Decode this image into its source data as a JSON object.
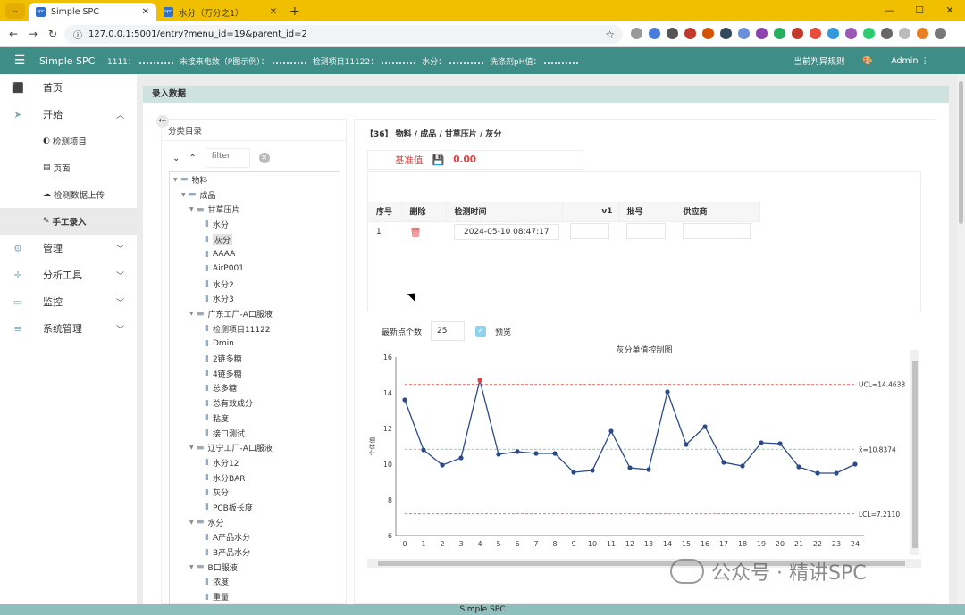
{
  "browser": {
    "tabs": [
      {
        "title": "Simple SPC",
        "active": true
      },
      {
        "title": "水分（万分之1）",
        "active": false
      }
    ],
    "url": "127.0.0.1:5001/entry?menu_id=19&parent_id=2",
    "window_controls": [
      "—",
      "☐",
      "✕"
    ]
  },
  "appbar": {
    "app_name": "Simple SPC",
    "ticker": [
      "1111：",
      "未接来电数（P图示例）：",
      "检测项目11122：",
      "水分：",
      "洗涤剂pH值："
    ],
    "rule_label": "当前判异规则",
    "user": "Admin"
  },
  "sidebar": {
    "items": [
      {
        "label": "首页",
        "icon": "home-icon"
      },
      {
        "label": "开始",
        "icon": "send-icon",
        "expanded": true
      },
      {
        "label": "管理",
        "icon": "gear-icon"
      },
      {
        "label": "分析工具",
        "icon": "crosshair-icon"
      },
      {
        "label": "监控",
        "icon": "monitor-icon"
      },
      {
        "label": "系统管理",
        "icon": "list-icon"
      }
    ],
    "sub_items": [
      {
        "label": "检测项目",
        "icon": "contrast-icon"
      },
      {
        "label": "页面",
        "icon": "book-icon"
      },
      {
        "label": "检测数据上传",
        "icon": "cloud-upload-icon"
      },
      {
        "label": "手工录入",
        "icon": "pen-icon",
        "active": true
      }
    ]
  },
  "page": {
    "title": "录入数据",
    "tree_title": "分类目录",
    "filter_placeholder": "filter",
    "breadcrumb": "【36】 物料 / 成品 / 甘草压片 / 灰分",
    "base_label": "基准值",
    "base_value": "0.00",
    "points_label": "最新点个数",
    "points_value": "25",
    "preview_label": "预览"
  },
  "tree": [
    {
      "label": "物料",
      "level": 0,
      "folder": true
    },
    {
      "label": "成品",
      "level": 1,
      "folder": true
    },
    {
      "label": "甘草压片",
      "level": 2,
      "folder": true
    },
    {
      "label": "水分",
      "level": 3
    },
    {
      "label": "灰分",
      "level": 3,
      "selected": true
    },
    {
      "label": "AAAA",
      "level": 3
    },
    {
      "label": "AirP001",
      "level": 3
    },
    {
      "label": "水分2",
      "level": 3
    },
    {
      "label": "水分3",
      "level": 3
    },
    {
      "label": "广东工厂-A口服液",
      "level": 2,
      "folder": true
    },
    {
      "label": "检测项目11122",
      "level": 3
    },
    {
      "label": "Dmin",
      "level": 3
    },
    {
      "label": "2链多糖",
      "level": 3
    },
    {
      "label": "4链多糖",
      "level": 3
    },
    {
      "label": "总多糖",
      "level": 3
    },
    {
      "label": "总有效成分",
      "level": 3
    },
    {
      "label": "粘度",
      "level": 3
    },
    {
      "label": "接口测试",
      "level": 3
    },
    {
      "label": "辽宁工厂-A口服液",
      "level": 2,
      "folder": true
    },
    {
      "label": "水分12",
      "level": 3
    },
    {
      "label": "水分BAR",
      "level": 3
    },
    {
      "label": "灰分",
      "level": 3
    },
    {
      "label": "PCB板长度",
      "level": 3
    },
    {
      "label": "水分",
      "level": 2,
      "folder": true
    },
    {
      "label": "A产品水分",
      "level": 3
    },
    {
      "label": "B产品水分",
      "level": 3
    },
    {
      "label": "B口服液",
      "level": 2,
      "folder": true
    },
    {
      "label": "浓度",
      "level": 3
    },
    {
      "label": "重量",
      "level": 3
    }
  ],
  "table": {
    "headers": [
      "序号",
      "删除",
      "检测时间",
      "v1",
      "批号",
      "供应商"
    ],
    "rows": [
      {
        "index": "1",
        "time": "2024-05-10 08:47:17",
        "v1": "",
        "batch": "",
        "supplier": ""
      }
    ]
  },
  "chart_data": {
    "type": "line",
    "title": "灰分单值控制图",
    "ylabel": "个体值",
    "x": [
      0,
      1,
      2,
      3,
      4,
      5,
      6,
      7,
      8,
      9,
      10,
      11,
      12,
      13,
      14,
      15,
      16,
      17,
      18,
      19,
      20,
      21,
      22,
      23,
      24
    ],
    "values": [
      13.6,
      10.8,
      9.95,
      10.35,
      14.7,
      10.55,
      10.7,
      10.6,
      10.6,
      9.55,
      9.65,
      11.85,
      9.8,
      9.7,
      14.05,
      11.1,
      12.1,
      10.1,
      9.9,
      11.2,
      11.15,
      9.85,
      9.5,
      9.5,
      10.0
    ],
    "ylim": [
      6,
      16
    ],
    "yticks": [
      6,
      8,
      10,
      12,
      14,
      16
    ],
    "ucl": 14.4638,
    "center": 10.8374,
    "lcl": 7.211,
    "ucl_label": "UCL=14.4638",
    "center_label": "x̄=10.8374",
    "lcl_label": "LCL=7.2110",
    "out_of_control_index": 4,
    "colors": {
      "line": "#2b4a8a",
      "limits": "#e04040",
      "center": "#5cc0a0",
      "alarm": "#e04040"
    }
  },
  "footer": "Simple SPC",
  "watermark": "公众号 · 精讲SPC"
}
